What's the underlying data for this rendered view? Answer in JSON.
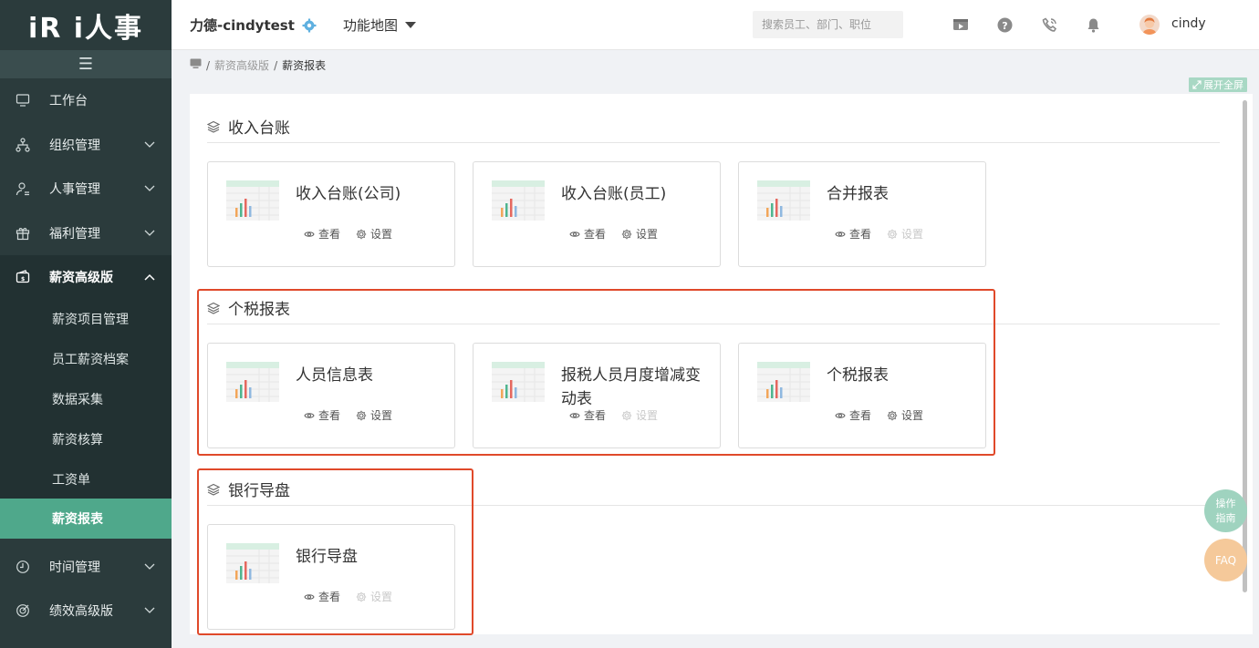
{
  "brand": {
    "logo": "iR i人事"
  },
  "sidebar": {
    "items": [
      {
        "label": "工作台",
        "icon": "monitor-icon"
      },
      {
        "label": "组织管理",
        "icon": "org-tree-icon"
      },
      {
        "label": "人事管理",
        "icon": "user-icon"
      },
      {
        "label": "福利管理",
        "icon": "gift-icon"
      },
      {
        "label": "薪资高级版",
        "icon": "wallet-icon"
      },
      {
        "label": "时间管理",
        "icon": "clock-icon"
      },
      {
        "label": "绩效高级版",
        "icon": "target-icon"
      }
    ],
    "sub_items": [
      {
        "label": "薪资项目管理"
      },
      {
        "label": "员工薪资档案"
      },
      {
        "label": "数据采集"
      },
      {
        "label": "薪资核算"
      },
      {
        "label": "工资单"
      },
      {
        "label": "薪资报表"
      }
    ]
  },
  "header": {
    "company": "力德-cindytest",
    "function_map": "功能地图",
    "search_placeholder": "搜索员工、部门、职位",
    "username": "cindy"
  },
  "breadcrumb": {
    "parent": "薪资高级版",
    "current": "薪资报表",
    "separator": "/"
  },
  "fullscreen_label": "展开全屏",
  "sections": [
    {
      "title": "收入台账",
      "cards": [
        {
          "title": "收入台账(公司)",
          "view": "查看",
          "settings": "设置",
          "settings_enabled": true
        },
        {
          "title": "收入台账(员工)",
          "view": "查看",
          "settings": "设置",
          "settings_enabled": true
        },
        {
          "title": "合并报表",
          "view": "查看",
          "settings": "设置",
          "settings_enabled": false
        }
      ]
    },
    {
      "title": "个税报表",
      "cards": [
        {
          "title": "人员信息表",
          "view": "查看",
          "settings": "设置",
          "settings_enabled": true
        },
        {
          "title": "报税人员月度增减变动表",
          "view": "查看",
          "settings": "设置",
          "settings_enabled": false
        },
        {
          "title": "个税报表",
          "view": "查看",
          "settings": "设置",
          "settings_enabled": true
        }
      ]
    },
    {
      "title": "银行导盘",
      "cards": [
        {
          "title": "银行导盘",
          "view": "查看",
          "settings": "设置",
          "settings_enabled": false
        }
      ]
    }
  ],
  "floating": {
    "guide": "操作指南",
    "faq": "FAQ"
  },
  "colors": {
    "sidebar_bg": "#2b3b3c",
    "accent": "#4fa88b",
    "highlight": "#e0492a"
  }
}
